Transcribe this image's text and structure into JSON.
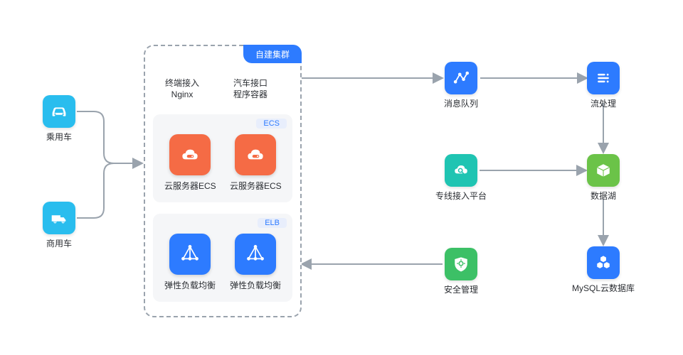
{
  "left": {
    "car": {
      "label": "乘用车"
    },
    "truck": {
      "label": "商用车"
    }
  },
  "cluster": {
    "tab": "自建集群",
    "topLeft": {
      "line1": "终端接入",
      "line2": "Nginx"
    },
    "topRight": {
      "line1": "汽车接口",
      "line2": "程序容器"
    },
    "ecs": {
      "tag": "ECS",
      "item1": "云服务器ECS",
      "item2": "云服务器ECS"
    },
    "elb": {
      "tag": "ELB",
      "item1": "弹性负载均衡",
      "item2": "弹性负载均衡"
    }
  },
  "mid": {
    "kafka": {
      "label": "消息队列"
    },
    "search": {
      "label": "专线接入平台"
    },
    "security": {
      "label": "安全管理"
    }
  },
  "right": {
    "stream": {
      "label": "流处理"
    },
    "storage": {
      "label": "数据湖"
    },
    "mysql": {
      "label": "MySQL云数据库"
    }
  },
  "colors": {
    "cyan": "#29bdee",
    "blue": "#2d7bff",
    "orange": "#f56b45",
    "teal": "#1fc4b2",
    "green": "#3cc066",
    "lime": "#6bc348"
  }
}
